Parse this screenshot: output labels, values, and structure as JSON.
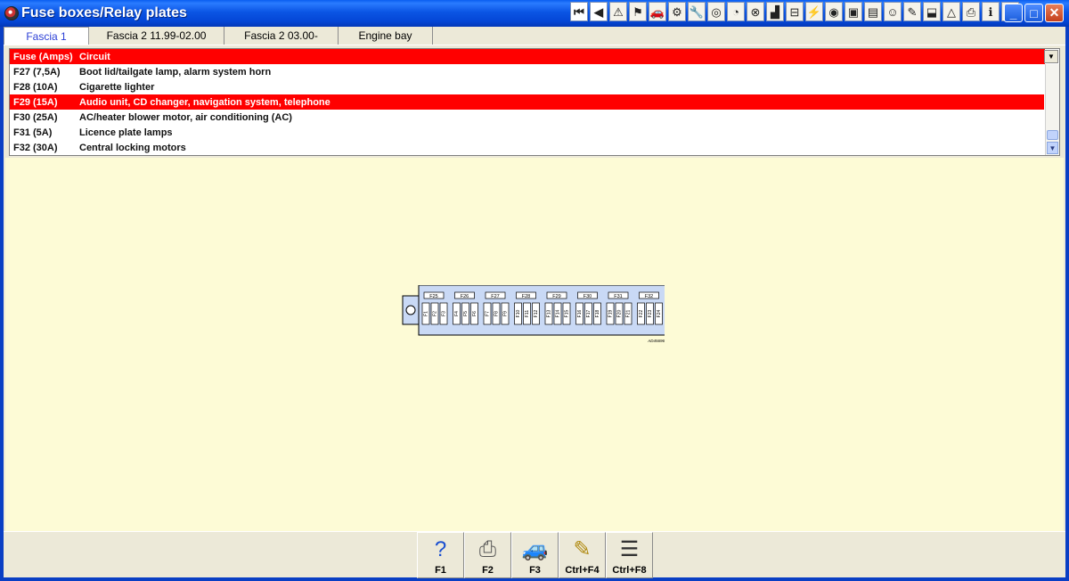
{
  "window": {
    "title": "Fuse boxes/Relay plates"
  },
  "toolbar_icons": [
    {
      "name": "first-page-icon",
      "glyph": "⏮",
      "nav": true
    },
    {
      "name": "back-arrow-icon",
      "glyph": "◀",
      "nav": true
    },
    {
      "name": "warning-icon",
      "glyph": "⚠",
      "nav": false
    },
    {
      "name": "flag-icon",
      "glyph": "⚑",
      "nav": false
    },
    {
      "name": "car-icon",
      "glyph": "🚗",
      "nav": false
    },
    {
      "name": "engine-icon",
      "glyph": "⚙",
      "nav": false
    },
    {
      "name": "tools-icon",
      "glyph": "🔧",
      "nav": false
    },
    {
      "name": "wheel-icon",
      "glyph": "◎",
      "nav": false
    },
    {
      "name": "gauge-icon",
      "glyph": "◔",
      "nav": false
    },
    {
      "name": "brake-icon",
      "glyph": "⊗",
      "nav": false
    },
    {
      "name": "seat-icon",
      "glyph": "▟",
      "nav": false
    },
    {
      "name": "chassis-icon",
      "glyph": "⊟",
      "nav": false
    },
    {
      "name": "electrical-icon",
      "glyph": "⚡",
      "nav": false
    },
    {
      "name": "airbag-icon",
      "glyph": "◉",
      "nav": false
    },
    {
      "name": "monitor-icon",
      "glyph": "▣",
      "nav": false
    },
    {
      "name": "document-icon",
      "glyph": "▤",
      "nav": false
    },
    {
      "name": "smiley-icon",
      "glyph": "☺",
      "nav": false
    },
    {
      "name": "paint-icon",
      "glyph": "✎",
      "nav": false
    },
    {
      "name": "body-icon",
      "glyph": "⬓",
      "nav": false
    },
    {
      "name": "alert-triangle-icon",
      "glyph": "△",
      "nav": false
    },
    {
      "name": "printer-icon",
      "glyph": "⎙",
      "nav": false
    },
    {
      "name": "info-icon",
      "glyph": "ℹ",
      "nav": false
    },
    {
      "name": "clipboard-icon",
      "glyph": "▥",
      "nav": false
    }
  ],
  "tabs": [
    {
      "label": "Fascia 1",
      "active": true
    },
    {
      "label": "Fascia 2 11.99-02.00",
      "active": false
    },
    {
      "label": "Fascia 2 03.00-",
      "active": false
    },
    {
      "label": "Engine bay",
      "active": false
    }
  ],
  "list": {
    "headers": {
      "fuse": "Fuse (Amps)",
      "circuit": "Circuit"
    },
    "rows": [
      {
        "fuse": "F27 (7,5A)",
        "circuit": "Boot lid/tailgate lamp, alarm system horn",
        "selected": false
      },
      {
        "fuse": "F28 (10A)",
        "circuit": "Cigarette lighter",
        "selected": false
      },
      {
        "fuse": "F29 (15A)",
        "circuit": "Audio unit, CD changer, navigation system, telephone",
        "selected": true
      },
      {
        "fuse": "F30 (25A)",
        "circuit": "AC/heater blower motor, air conditioning (AC)",
        "selected": false
      },
      {
        "fuse": "F31 (5A)",
        "circuit": "Licence plate lamps",
        "selected": false
      },
      {
        "fuse": "F32 (30A)",
        "circuit": "Central locking motors",
        "selected": false
      }
    ]
  },
  "diagram": {
    "top_fuses": [
      "F25",
      "F26",
      "F27",
      "F28",
      "F29",
      "F30",
      "F31",
      "F32"
    ],
    "small_fuses": [
      "F1",
      "F2",
      "F3",
      "F4",
      "F5",
      "F6",
      "F7",
      "F8",
      "F9",
      "F10",
      "F11",
      "F12",
      "F13",
      "F14",
      "F15",
      "F16",
      "F17",
      "F18",
      "F19",
      "F20",
      "F21",
      "F22",
      "F23",
      "F24"
    ],
    "code": "AD45696"
  },
  "bottom_buttons": [
    {
      "label": "F1",
      "icon": "help-icon",
      "glyph": "?",
      "color": "#1a4fd0"
    },
    {
      "label": "F2",
      "icon": "printer-icon",
      "glyph": "⎙",
      "color": "#555555"
    },
    {
      "label": "F3",
      "icon": "car-view-icon",
      "glyph": "🚙",
      "color": "#3a7ad0"
    },
    {
      "label": "Ctrl+F4",
      "icon": "notepad-icon",
      "glyph": "✎",
      "color": "#b08a10"
    },
    {
      "label": "Ctrl+F8",
      "icon": "list-icon",
      "glyph": "☰",
      "color": "#333333"
    }
  ]
}
